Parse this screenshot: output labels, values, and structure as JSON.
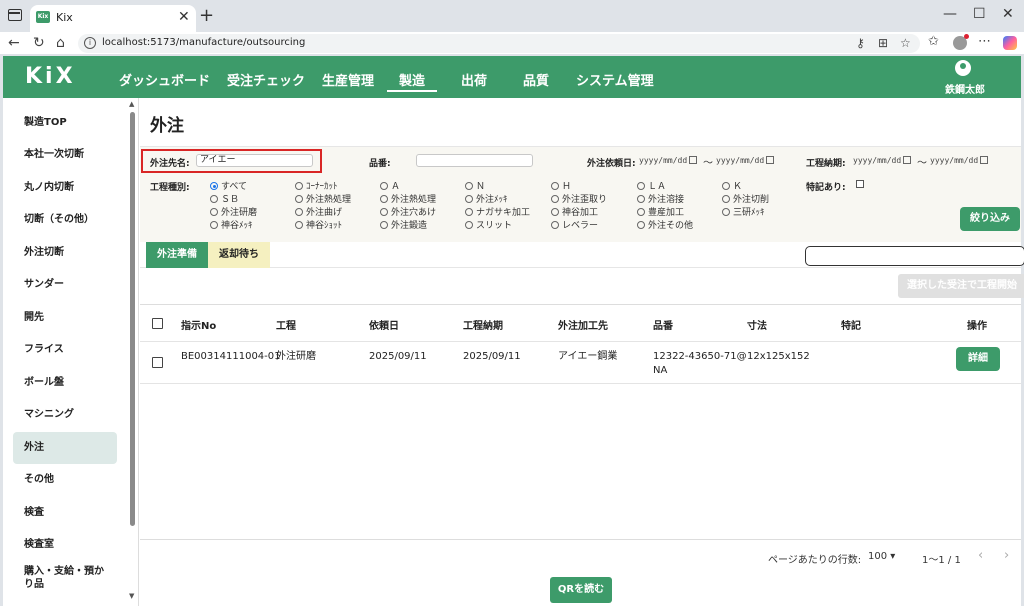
{
  "browser": {
    "tab_title": "Kix",
    "favicon_text": "Kix",
    "url": "localhost:5173/manufacture/outsourcing"
  },
  "app": {
    "logo": "KiX",
    "nav": [
      "ダッシュボード",
      "受注チェック",
      "生産管理",
      "製造",
      "出荷",
      "品質",
      "システム管理"
    ],
    "active_nav": "製造",
    "user_name": "鉄鋼太郎"
  },
  "sidebar": {
    "items": [
      "製造TOP",
      "本社一次切断",
      "丸ノ内切断",
      "切断（その他）",
      "外注切断",
      "サンダー",
      "開先",
      "フライス",
      "ボール盤",
      "マシニング",
      "外注",
      "その他",
      "検査",
      "検査室",
      "購入・支給・預かり品"
    ],
    "active": "外注"
  },
  "page": {
    "title": "外注"
  },
  "filters": {
    "vendor_label": "外注先名:",
    "vendor_value": "アイエー",
    "part_label": "品番:",
    "part_value": "",
    "request_date_label": "外注依頼日:",
    "process_due_label": "工程納期:",
    "date_placeholder": "yyyy/mm/dd",
    "tilde": "〜",
    "special_label": "特記あり:",
    "process_type_label": "工程種別:",
    "process_types": [
      [
        "すべて",
        "ｺｰﾅｰｶｯﾄ",
        "Ａ",
        "Ｎ",
        "Ｈ",
        "ＬＡ",
        "Ｋ"
      ],
      [
        "ＳＢ",
        "外注熱処理",
        "外注熱処理",
        "外注ﾒｯｷ",
        "外注歪取り",
        "外注溶接",
        "外注切削"
      ],
      [
        "外注研磨",
        "外注曲げ",
        "外注穴あけ",
        "ナガサキ加工",
        "神谷加工",
        "豊産加工",
        "三研ﾒｯｷ"
      ],
      [
        "神谷ﾒｯｷ",
        "神谷ｼｮｯﾄ",
        "外注鍛造",
        "スリット",
        "レベラー",
        "外注その他"
      ]
    ],
    "selected_type": "すべて",
    "filter_button": "絞り込み"
  },
  "tabs": {
    "prep": "外注準備",
    "waiting": "返却待ち"
  },
  "actions": {
    "start_selected": "選択した受注で工程開始",
    "qr": "QRを読む"
  },
  "table": {
    "headers": [
      "指示No",
      "工程",
      "依頼日",
      "工程納期",
      "外注加工先",
      "品番",
      "寸法",
      "特記",
      "操作"
    ],
    "rows": [
      {
        "no": "BE00314111004-01",
        "process": "外注研磨",
        "request_date": "2025/09/11",
        "due": "2025/09/11",
        "vendor": "アイエー鋼業",
        "part_line1": "12322-43650-71@",
        "part_line2": "NA",
        "size": "12x125x152",
        "note": "",
        "action": "詳細"
      }
    ]
  },
  "pager": {
    "rows_label": "ページあたりの行数:",
    "rows_value": "100",
    "range": "1〜1 / 1"
  },
  "colors": {
    "brand_green": "#3d9b6a",
    "highlight_red": "#d92626"
  }
}
